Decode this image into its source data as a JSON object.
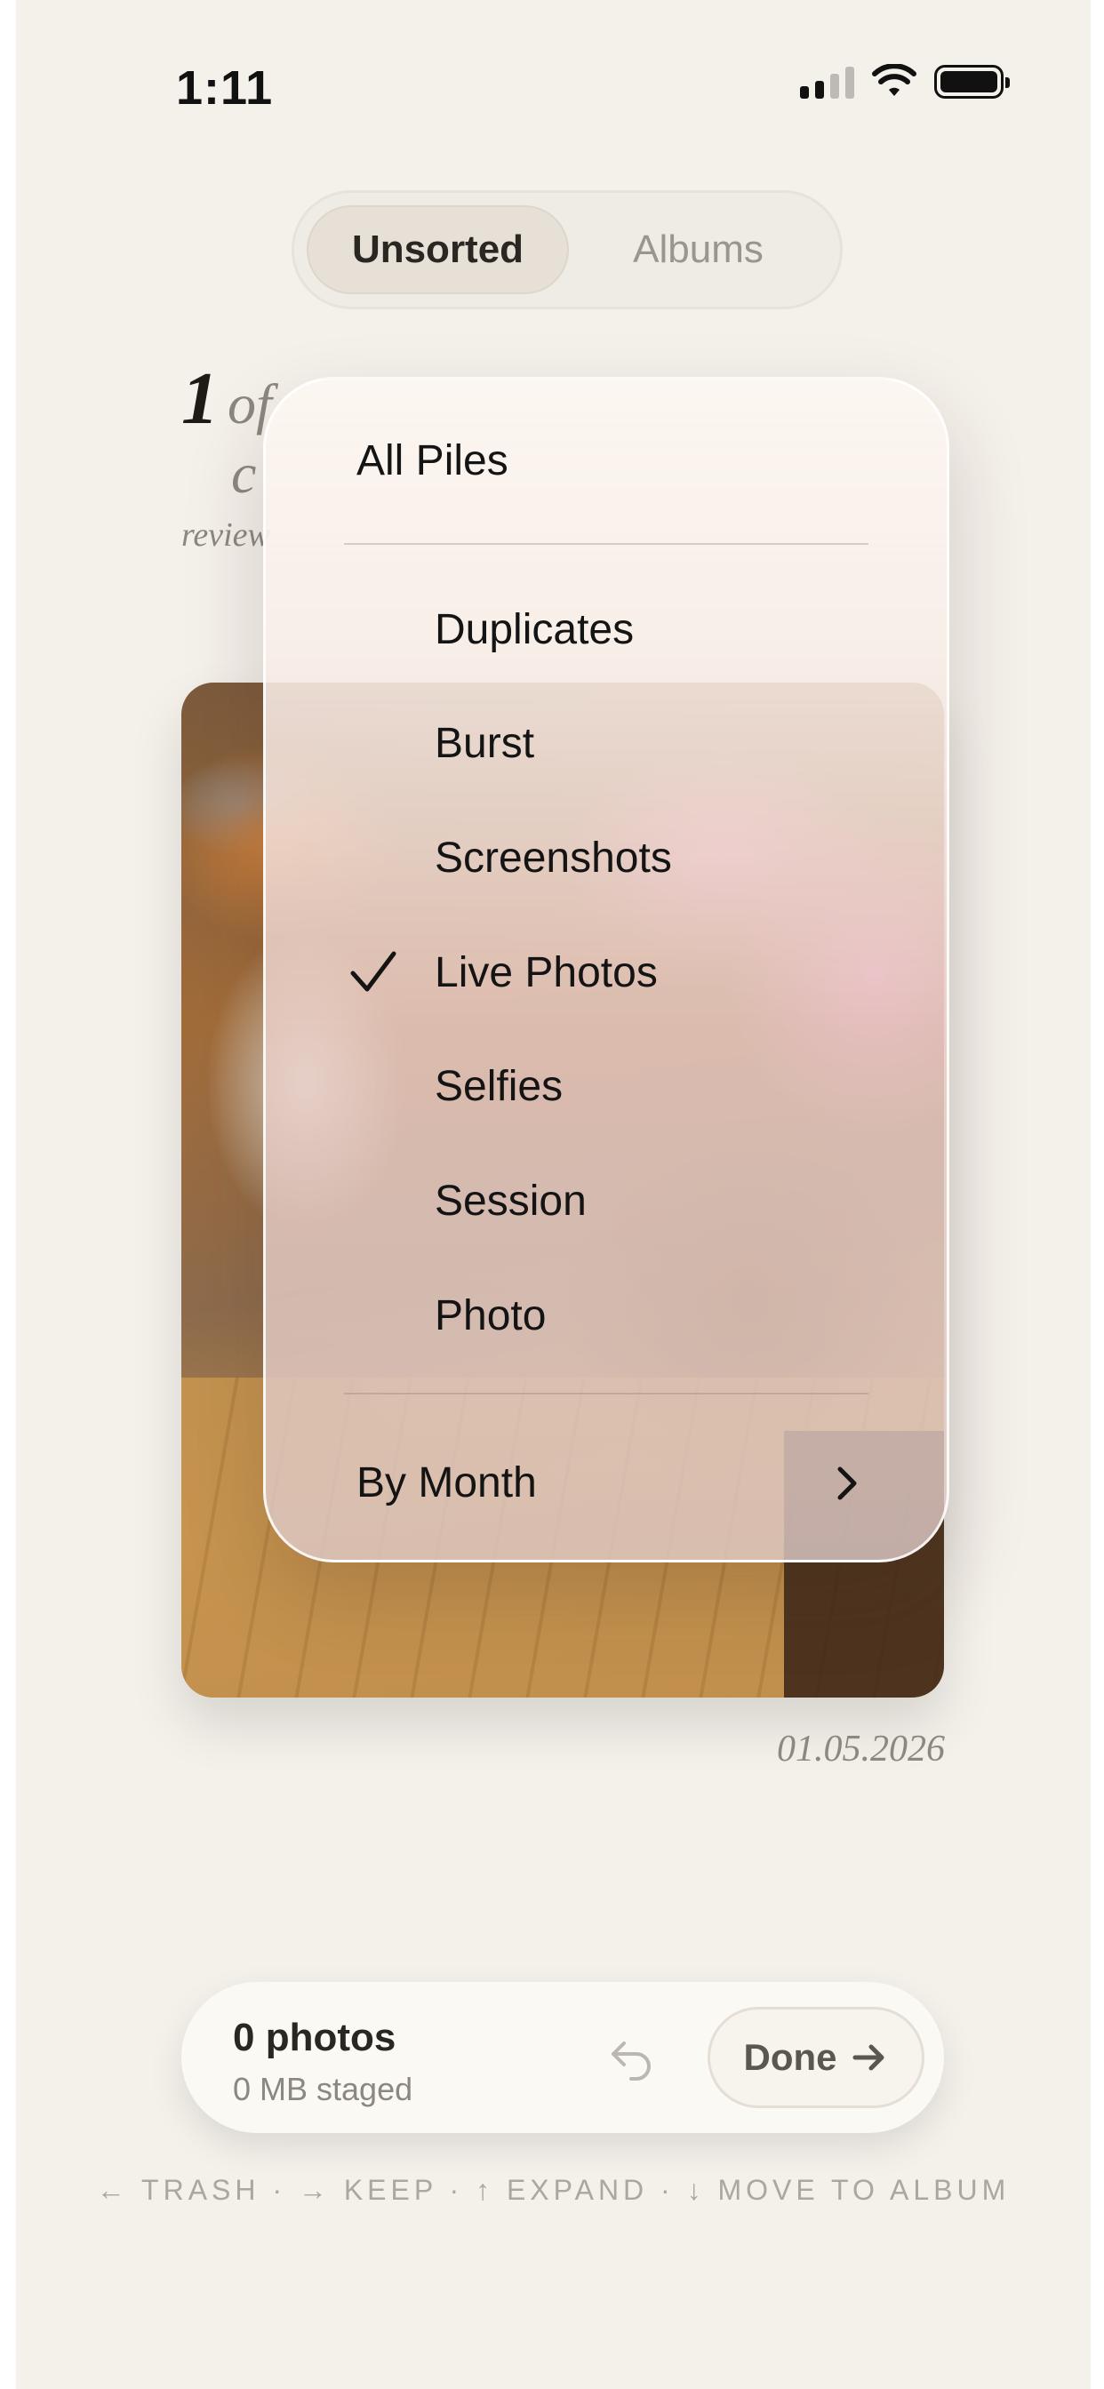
{
  "status_bar": {
    "time": "1:11"
  },
  "tabs": [
    {
      "label": "Unsorted",
      "active": true
    },
    {
      "label": "Albums",
      "active": false
    }
  ],
  "counter": {
    "current": "1",
    "of_text": "of",
    "line2": "c",
    "subtitle": "review"
  },
  "photo": {
    "date": "01.05.2026"
  },
  "menu": {
    "header": "All Piles",
    "items": [
      {
        "label": "Duplicates",
        "checked": false
      },
      {
        "label": "Burst",
        "checked": false
      },
      {
        "label": "Screenshots",
        "checked": false
      },
      {
        "label": "Live Photos",
        "checked": true
      },
      {
        "label": "Selfies",
        "checked": false
      },
      {
        "label": "Session",
        "checked": false
      },
      {
        "label": "Photo",
        "checked": false
      }
    ],
    "footer": "By Month"
  },
  "staging": {
    "count": "0 photos",
    "size": "0 MB staged",
    "done_label": "Done"
  },
  "hint": "← TRASH · → KEEP · ↑ EXPAND · ↓ MOVE TO ALBUM",
  "icons": {
    "undo": "undo-icon",
    "done": "arrow-right-icon",
    "check": "checkmark-icon",
    "submenu": "chevron-right-icon"
  }
}
